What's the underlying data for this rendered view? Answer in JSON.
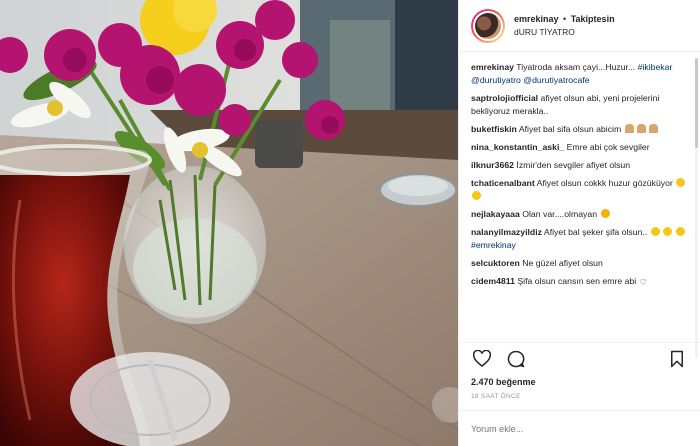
{
  "post": {
    "username": "emrekinay",
    "dot": "•",
    "follow_status": "Takiptesin",
    "location": "dURU TİYATRO",
    "like_count": "2.470 beğenme",
    "timestamp": "18 SAAT ÖNCE",
    "comment_placeholder": "Yorum ekle..."
  },
  "caption": {
    "username": "emrekinay",
    "text": "Tiyatroda aksam çayi...Huzur...",
    "tags": "#ikibekar @durutiyatro @durutiyatrocafe"
  },
  "comments": [
    {
      "username": "saptrolojiofficial",
      "text": "afiyet olsun abi, yeni projelerini bekliyoruz merakla.."
    },
    {
      "username": "buketfiskin",
      "text": "Afiyet bal sifa olsun abicim"
    },
    {
      "username": "nina_konstantin_aski_",
      "text": "Emre abi çok sevgiler"
    },
    {
      "username": "ilknur3662",
      "text": "İzmir'den sevgiler afiyet olsun"
    },
    {
      "username": "tchaticenalbant",
      "text": "Afiyet olsun cokkk huzur gözüküyor"
    },
    {
      "username": "nejlakayaaa",
      "text": "Olan var....olmayan"
    },
    {
      "username": "nalanyilmazyildiz",
      "text": "Afiyet bal şeker şifa olsun..",
      "tag": "#emrekinay"
    },
    {
      "username": "selcuktoren",
      "text": "Ne güzel afiyet olsun"
    },
    {
      "username": "cidem4811",
      "text": "Şifa olsun cansın sen emre abi"
    }
  ],
  "icons": {
    "like": "heart-icon",
    "comment": "comment-icon",
    "save": "bookmark-icon"
  },
  "colors": {
    "text": "#262626",
    "link": "#003569",
    "muted": "#999999",
    "border": "#efefef"
  }
}
